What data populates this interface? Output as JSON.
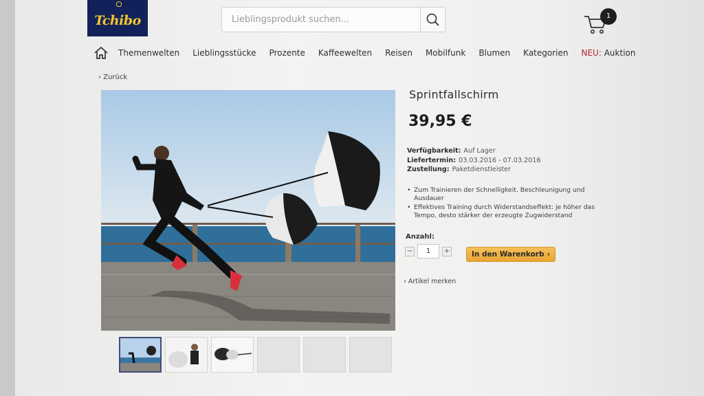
{
  "header": {
    "logo_text": "Tchibo",
    "search_placeholder": "Lieblingsprodukt suchen...",
    "cart_count": "1"
  },
  "nav": {
    "items": [
      "Themenwelten",
      "Lieblingsstücke",
      "Prozente",
      "Kaffeewelten",
      "Reisen",
      "Mobilfunk",
      "Blumen",
      "Kategorien"
    ],
    "new_prefix": "NEU:",
    "new_label": "Auktion"
  },
  "back_label": "› Zurück",
  "product": {
    "title": "Sprintfallschirm",
    "price": "39,95 €",
    "availability_label": "Verfügbarkeit:",
    "availability_value": "Auf Lager",
    "delivery_label": "Liefertermin:",
    "delivery_value": "03.03.2016 - 07.03.2016",
    "shipping_label": "Zustellung:",
    "shipping_value": "Paketdienstleister",
    "bullets": [
      "Zum Trainieren der Schnelligkeit, Beschleunigung und Ausdauer",
      "Effektives Training durch Widerstandseffekt: je höher das Tempo, desto stärker der erzeugte Zugwiderstand"
    ],
    "qty_label": "Anzahl:",
    "qty_value": "1",
    "minus": "−",
    "plus": "+",
    "add_to_cart": "In den Warenkorb",
    "add_arrow": "›",
    "save_label": "› Artikel merken"
  }
}
